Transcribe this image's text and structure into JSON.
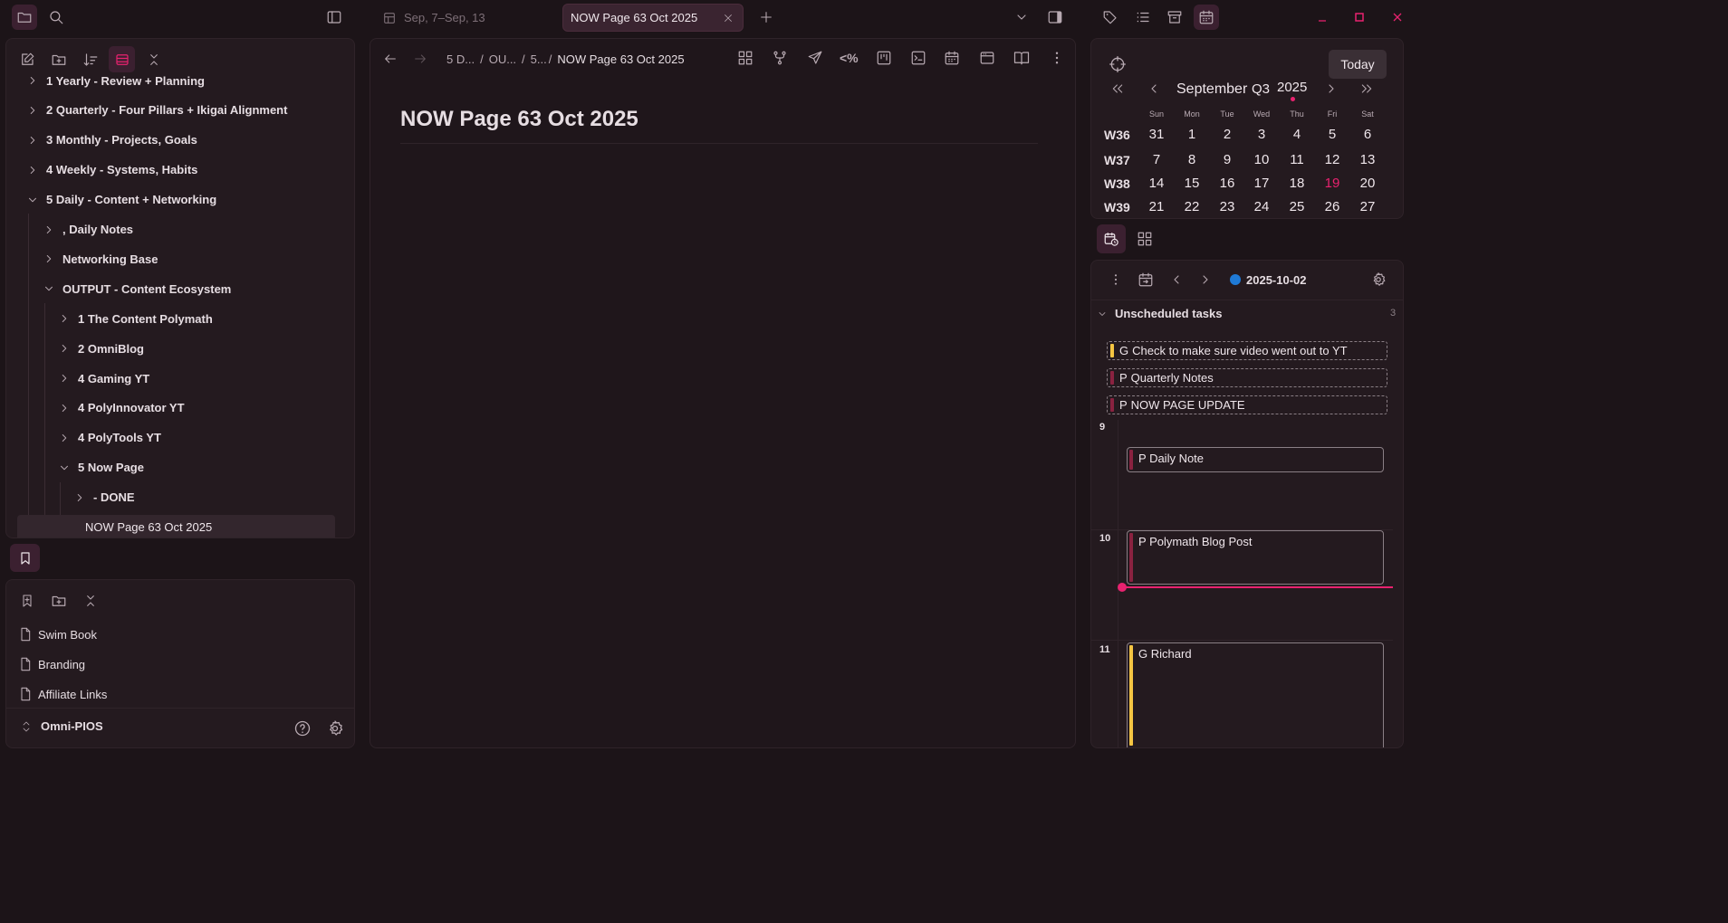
{
  "titlebar": {
    "tabs": [
      {
        "label": "Sep, 7–Sep, 13",
        "active": false
      },
      {
        "label": "NOW Page 63 Oct 2025",
        "active": true
      }
    ]
  },
  "sidebar": {
    "tree": [
      {
        "label": "1 Yearly - Review + Planning",
        "expanded": false,
        "depth": 0
      },
      {
        "label": "2 Quarterly - Four Pillars + Ikigai Alignment",
        "expanded": false,
        "depth": 0
      },
      {
        "label": "3 Monthly - Projects, Goals",
        "expanded": false,
        "depth": 0
      },
      {
        "label": "4 Weekly - Systems, Habits",
        "expanded": false,
        "depth": 0
      },
      {
        "label": "5 Daily - Content + Networking",
        "expanded": true,
        "depth": 0
      },
      {
        "label": ", Daily Notes",
        "expanded": false,
        "depth": 1
      },
      {
        "label": "Networking Base",
        "expanded": false,
        "depth": 1
      },
      {
        "label": "OUTPUT - Content Ecosystem",
        "expanded": true,
        "depth": 1
      },
      {
        "label": "1 The Content Polymath",
        "expanded": false,
        "depth": 2
      },
      {
        "label": "2 OmniBlog",
        "expanded": false,
        "depth": 2
      },
      {
        "label": "4 Gaming YT",
        "expanded": false,
        "depth": 2
      },
      {
        "label": "4 PolyInnovator YT",
        "expanded": false,
        "depth": 2
      },
      {
        "label": "4 PolyTools YT",
        "expanded": false,
        "depth": 2
      },
      {
        "label": "5 Now Page",
        "expanded": true,
        "depth": 2
      },
      {
        "label": "- DONE",
        "expanded": false,
        "depth": 3
      }
    ],
    "selected_file": "NOW Page 63 Oct 2025",
    "bookmarks": [
      "Swim Book",
      "Branding",
      "Affiliate Links"
    ],
    "vault_name": "Omni-PIOS"
  },
  "editor": {
    "breadcrumb": [
      "5 D...",
      "OU...",
      "5...",
      "NOW Page 63 Oct 2025"
    ],
    "title": "NOW Page 63 Oct 2025",
    "percent_icon_text": "<%"
  },
  "calendar": {
    "today_button": "Today",
    "month": "September",
    "quarter": "Q3",
    "year": "2025",
    "days_of_week": [
      "Sun",
      "Mon",
      "Tue",
      "Wed",
      "Thu",
      "Fri",
      "Sat"
    ],
    "weeks": [
      {
        "label": "W36",
        "days": [
          "31",
          "1",
          "2",
          "3",
          "4",
          "5",
          "6"
        ]
      },
      {
        "label": "W37",
        "days": [
          "7",
          "8",
          "9",
          "10",
          "11",
          "12",
          "13"
        ]
      },
      {
        "label": "W38",
        "days": [
          "14",
          "15",
          "16",
          "17",
          "18",
          "19",
          "20"
        ]
      },
      {
        "label": "W39",
        "days": [
          "21",
          "22",
          "23",
          "24",
          "25",
          "26",
          "27"
        ]
      }
    ],
    "today_day": "19",
    "highlight_color": "#e8226f"
  },
  "planner": {
    "date": "2025-10-02",
    "unscheduled_label": "Unscheduled tasks",
    "unscheduled_count": "3",
    "unscheduled": [
      {
        "prefix": "G",
        "label": "Check to make sure video went out to YT",
        "color": "#f5c542"
      },
      {
        "prefix": "P",
        "label": "Quarterly Notes",
        "color": "#8a2240"
      },
      {
        "prefix": "P",
        "label": "NOW PAGE UPDATE",
        "color": "#8a2240"
      }
    ],
    "hours": [
      "9",
      "10",
      "11"
    ],
    "events": [
      {
        "prefix": "P",
        "label": "Daily Note",
        "color": "#8a2240"
      },
      {
        "prefix": "P",
        "label": "Polymath Blog Post",
        "color": "#8a2240"
      },
      {
        "prefix": "G",
        "label": "Richard",
        "color": "#f5c542"
      }
    ]
  }
}
